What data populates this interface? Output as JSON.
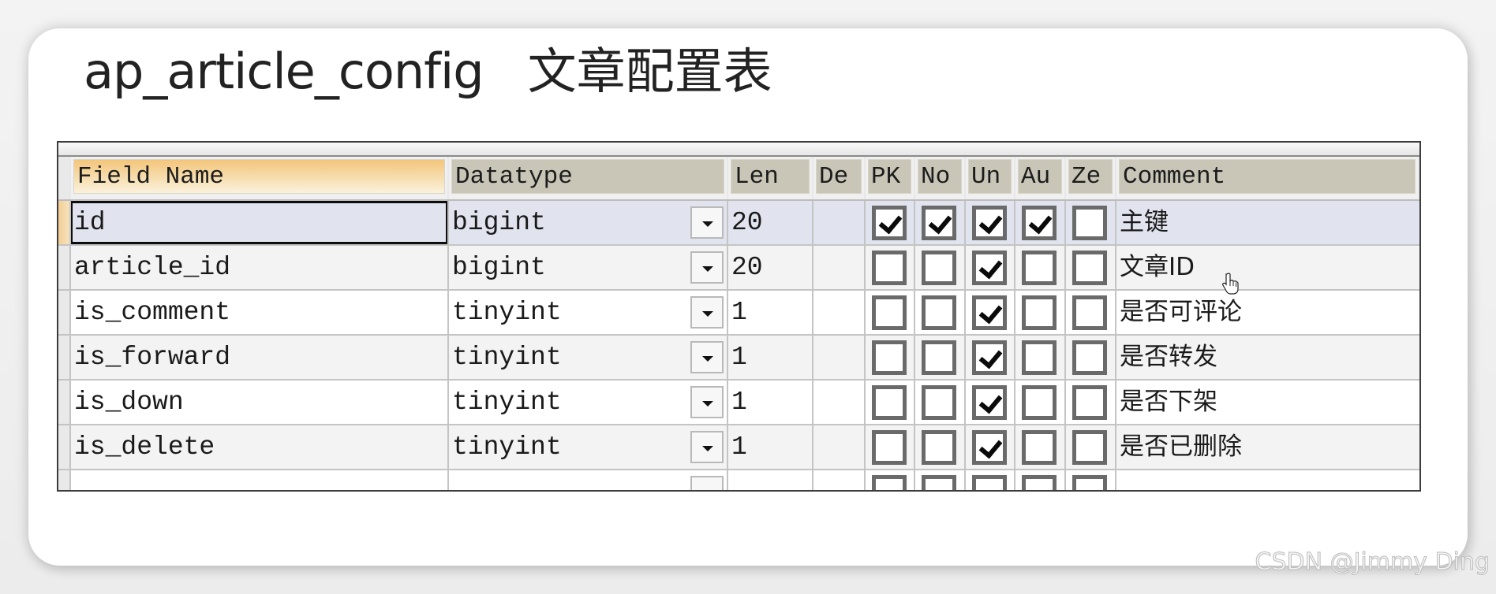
{
  "title": {
    "table_name": "ap_article_config",
    "description": "文章配置表"
  },
  "grid": {
    "columns": {
      "field_name": "Field Name",
      "datatype": "Datatype",
      "len": "Len",
      "default": "De",
      "pk": "PK",
      "not_null": "No",
      "unsigned": "Un",
      "auto_increment": "Au",
      "zerofill": "Ze",
      "comment": "Comment"
    },
    "rows": [
      {
        "field": "id",
        "datatype": "bigint",
        "len": "20",
        "default": "",
        "pk": true,
        "not_null": true,
        "unsigned": true,
        "auto_increment": true,
        "zerofill": false,
        "comment": "主键",
        "selected": true
      },
      {
        "field": "article_id",
        "datatype": "bigint",
        "len": "20",
        "default": "",
        "pk": false,
        "not_null": false,
        "unsigned": true,
        "auto_increment": false,
        "zerofill": false,
        "comment": "文章ID",
        "selected": false
      },
      {
        "field": "is_comment",
        "datatype": "tinyint",
        "len": "1",
        "default": "",
        "pk": false,
        "not_null": false,
        "unsigned": true,
        "auto_increment": false,
        "zerofill": false,
        "comment": "是否可评论",
        "selected": false
      },
      {
        "field": "is_forward",
        "datatype": "tinyint",
        "len": "1",
        "default": "",
        "pk": false,
        "not_null": false,
        "unsigned": true,
        "auto_increment": false,
        "zerofill": false,
        "comment": "是否转发",
        "selected": false
      },
      {
        "field": "is_down",
        "datatype": "tinyint",
        "len": "1",
        "default": "",
        "pk": false,
        "not_null": false,
        "unsigned": true,
        "auto_increment": false,
        "zerofill": false,
        "comment": "是否下架",
        "selected": false
      },
      {
        "field": "is_delete",
        "datatype": "tinyint",
        "len": "1",
        "default": "",
        "pk": false,
        "not_null": false,
        "unsigned": true,
        "auto_increment": false,
        "zerofill": false,
        "comment": "是否已删除",
        "selected": false
      },
      {
        "field": "",
        "datatype": "",
        "len": "",
        "default": "",
        "pk": false,
        "not_null": false,
        "unsigned": false,
        "auto_increment": false,
        "zerofill": false,
        "comment": "",
        "selected": false
      }
    ]
  },
  "watermark": "CSDN @Jimmy Ding",
  "colors": {
    "header_bg": "#c9c6b8",
    "selected_row_bg": "#e1e4ee",
    "active_header": "#f3c57a"
  }
}
